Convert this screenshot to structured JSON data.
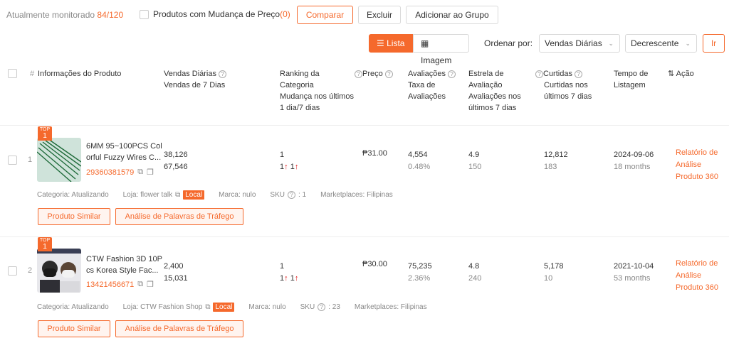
{
  "topbar": {
    "monitor_label": "Atualmente monitorado",
    "monitor_count": "84/120",
    "changed_label": "Produtos com Mudança de Preço",
    "changed_count": "(0)",
    "compare": "Comparar",
    "delete": "Excluir",
    "add_group": "Adicionar ao Grupo"
  },
  "view": {
    "list": "Lista",
    "image": "Imagem",
    "sort_label": "Ordenar por:",
    "sort_value": "Vendas Diárias",
    "order_value": "Decrescente",
    "go": "Ir"
  },
  "columns": {
    "hash": "#",
    "info": "Informações do Produto",
    "sales_1": "Vendas Diárias",
    "sales_2": "Vendas de 7 Dias",
    "rank_1": "Ranking da",
    "rank_2": "Categoria",
    "rank_3": "Mudança nos últimos",
    "rank_4": "1 dia/7 dias",
    "price": "Preço",
    "reviews_1": "Avaliações",
    "reviews_2": "Taxa de",
    "reviews_3": "Avaliações",
    "star_1": "Estrela de",
    "star_2": "Avaliação",
    "star_3": "Avaliações nos",
    "star_4": "últimos 7 dias",
    "likes_1": "Curtidas",
    "likes_2": "Curtidas nos",
    "likes_3": "últimos 7 dias",
    "listing_1": "Tempo de",
    "listing_2": "Listagem",
    "action": "Ação"
  },
  "rows": [
    {
      "index": "1",
      "badge_top": "TOP",
      "badge_num": "1",
      "name_1": "6MM 95~100PCS Col",
      "name_2": "orful Fuzzy Wires C...",
      "id": "29360381579",
      "sales_daily": "38,126",
      "sales_7d": "67,546",
      "rank": "1",
      "rank_change_1d": "1",
      "rank_change_7d": "1",
      "price": "₱31.00",
      "reviews": "4,554",
      "review_rate": "0.48%",
      "star": "4.9",
      "reviews_7d": "150",
      "likes": "12,812",
      "likes_7d": "183",
      "listed": "2024-09-06",
      "age": "18 months",
      "action_1": "Relatório de",
      "action_2": "Análise",
      "action_3": "Produto 360",
      "category": "Categoria: Atualizando",
      "shop": "Loja: flower talk",
      "local": "Local",
      "brand": "Marca: nulo",
      "sku_label": "SKU",
      "sku_value": ": 1",
      "marketplaces": "Marketplaces: Filipinas",
      "similar": "Produto Similar",
      "keywords": "Análise de Palavras de Tráfego"
    },
    {
      "index": "2",
      "badge_top": "TOP",
      "badge_num": "1",
      "name_1": "CTW Fashion 3D 10P",
      "name_2": "cs Korea Style Fac...",
      "id": "13421456671",
      "sales_daily": "2,400",
      "sales_7d": "15,031",
      "rank": "1",
      "rank_change_1d": "1",
      "rank_change_7d": "1",
      "price": "₱30.00",
      "reviews": "75,235",
      "review_rate": "2.36%",
      "star": "4.8",
      "reviews_7d": "240",
      "likes": "5,178",
      "likes_7d": "10",
      "listed": "2021-10-04",
      "age": "53 months",
      "action_1": "Relatório de",
      "action_2": "Análise",
      "action_3": "Produto 360",
      "category": "Categoria: Atualizando",
      "shop": "Loja: CTW Fashion Shop",
      "local": "Local",
      "brand": "Marca: nulo",
      "sku_label": "SKU",
      "sku_value": ": 23",
      "marketplaces": "Marketplaces: Filipinas",
      "similar": "Produto Similar",
      "keywords": "Análise de Palavras de Tráfego"
    }
  ],
  "colors": {
    "accent": "#f5692c",
    "up_arrow": "#e02020"
  }
}
